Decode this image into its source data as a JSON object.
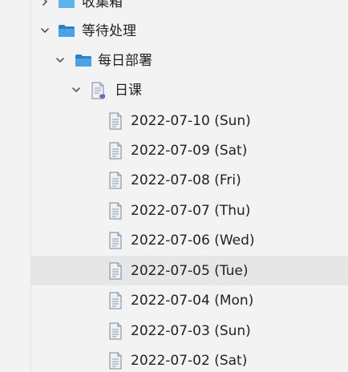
{
  "tree": {
    "nodes": [
      {
        "id": "favorites",
        "label": "收集箱",
        "kind": "folder",
        "expanded": false
      },
      {
        "id": "pending",
        "label": "等待处理",
        "kind": "folder",
        "expanded": true
      },
      {
        "id": "daily",
        "label": "每日部署",
        "kind": "folder",
        "expanded": true
      },
      {
        "id": "lessons",
        "label": "日课",
        "kind": "notebook",
        "expanded": true
      },
      {
        "id": "d0710",
        "label": "2022-07-10 (Sun)",
        "kind": "note"
      },
      {
        "id": "d0709",
        "label": "2022-07-09 (Sat)",
        "kind": "note"
      },
      {
        "id": "d0708",
        "label": "2022-07-08 (Fri)",
        "kind": "note"
      },
      {
        "id": "d0707",
        "label": "2022-07-07 (Thu)",
        "kind": "note"
      },
      {
        "id": "d0706",
        "label": "2022-07-06 (Wed)",
        "kind": "note"
      },
      {
        "id": "d0705",
        "label": "2022-07-05 (Tue)",
        "kind": "note",
        "selected": true
      },
      {
        "id": "d0704",
        "label": "2022-07-04 (Mon)",
        "kind": "note"
      },
      {
        "id": "d0703",
        "label": "2022-07-03 (Sun)",
        "kind": "note"
      },
      {
        "id": "d0702",
        "label": "2022-07-02 (Sat)",
        "kind": "note"
      }
    ]
  },
  "colors": {
    "folder": "#4aa3e8",
    "folder_dark": "#2f7fc4",
    "selected_row": "#e6e6e6",
    "background": "#f3f3f3",
    "notebook_badge": "#7b5fc7"
  }
}
